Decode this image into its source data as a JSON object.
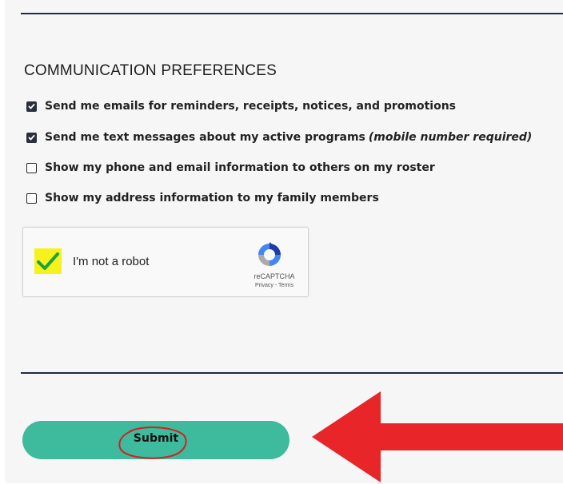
{
  "section": {
    "title": "COMMUNICATION PREFERENCES"
  },
  "preferences": [
    {
      "label": "Send me emails for reminders, receipts, notices, and promotions",
      "note": "",
      "checked": true
    },
    {
      "label": "Send me text messages about my active programs",
      "note": "(mobile number required)",
      "checked": true
    },
    {
      "label": "Show my phone and email information to others on my roster",
      "note": "",
      "checked": false
    },
    {
      "label": "Show my address information to my family members",
      "note": "",
      "checked": false
    }
  ],
  "captcha": {
    "label": "I'm not a robot",
    "brand": "reCAPTCHA",
    "privacy": "Privacy",
    "separator": " - ",
    "terms": "Terms",
    "checked": true
  },
  "submit": {
    "label": "Submit"
  },
  "colors": {
    "accent": "#3dbb9c",
    "divider": "#1e2a4a",
    "highlight": "#f7f21c",
    "annotation_red": "#e8262a"
  }
}
